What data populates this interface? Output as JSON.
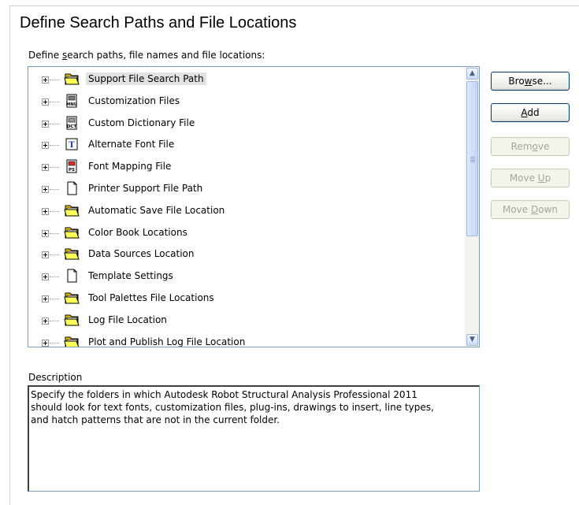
{
  "header": {
    "title": "Define Search Paths and File Locations",
    "subtitle_pre": "Define ",
    "subtitle_accel": "s",
    "subtitle_post": "earch paths, file names and file locations:"
  },
  "tree": {
    "items": [
      {
        "label": "Support File Search Path",
        "icon": "folder-icon",
        "selected": true
      },
      {
        "label": "Customization Files",
        "icon": "mnu-file-icon"
      },
      {
        "label": "Custom Dictionary File",
        "icon": "dct-file-icon"
      },
      {
        "label": "Alternate Font File",
        "icon": "font-file-icon"
      },
      {
        "label": "Font Mapping File",
        "icon": "ps-file-icon"
      },
      {
        "label": "Printer Support File Path",
        "icon": "document-icon"
      },
      {
        "label": "Automatic Save File Location",
        "icon": "folder-icon"
      },
      {
        "label": "Color Book Locations",
        "icon": "folder-icon"
      },
      {
        "label": "Data Sources Location",
        "icon": "folder-icon"
      },
      {
        "label": "Template Settings",
        "icon": "document-icon"
      },
      {
        "label": "Tool Palettes File Locations",
        "icon": "folder-icon"
      },
      {
        "label": "Log File Location",
        "icon": "folder-icon"
      },
      {
        "label": "Plot and Publish Log File Location",
        "icon": "folder-icon"
      }
    ]
  },
  "buttons": {
    "browse": {
      "pre": "Bro",
      "accel": "w",
      "post": "se..."
    },
    "add": {
      "pre": "",
      "accel": "A",
      "post": "dd"
    },
    "remove": {
      "pre": "Rem",
      "accel": "o",
      "post": "ve"
    },
    "move_up": {
      "pre": "Move ",
      "accel": "U",
      "post": "p"
    },
    "move_down": {
      "pre": "Move ",
      "accel": "D",
      "post": "own"
    }
  },
  "description": {
    "label": "Description",
    "lines": [
      "Specify the folders in which Autodesk Robot Structural Analysis Professional 2011",
      "should look for text fonts, customization files, plug-ins, drawings to insert, line types,",
      "and hatch patterns that are not in the current folder."
    ]
  },
  "colors": {
    "folder": "#ffff5a",
    "selection": "#e2e2e2",
    "border": "#7f9db9"
  }
}
